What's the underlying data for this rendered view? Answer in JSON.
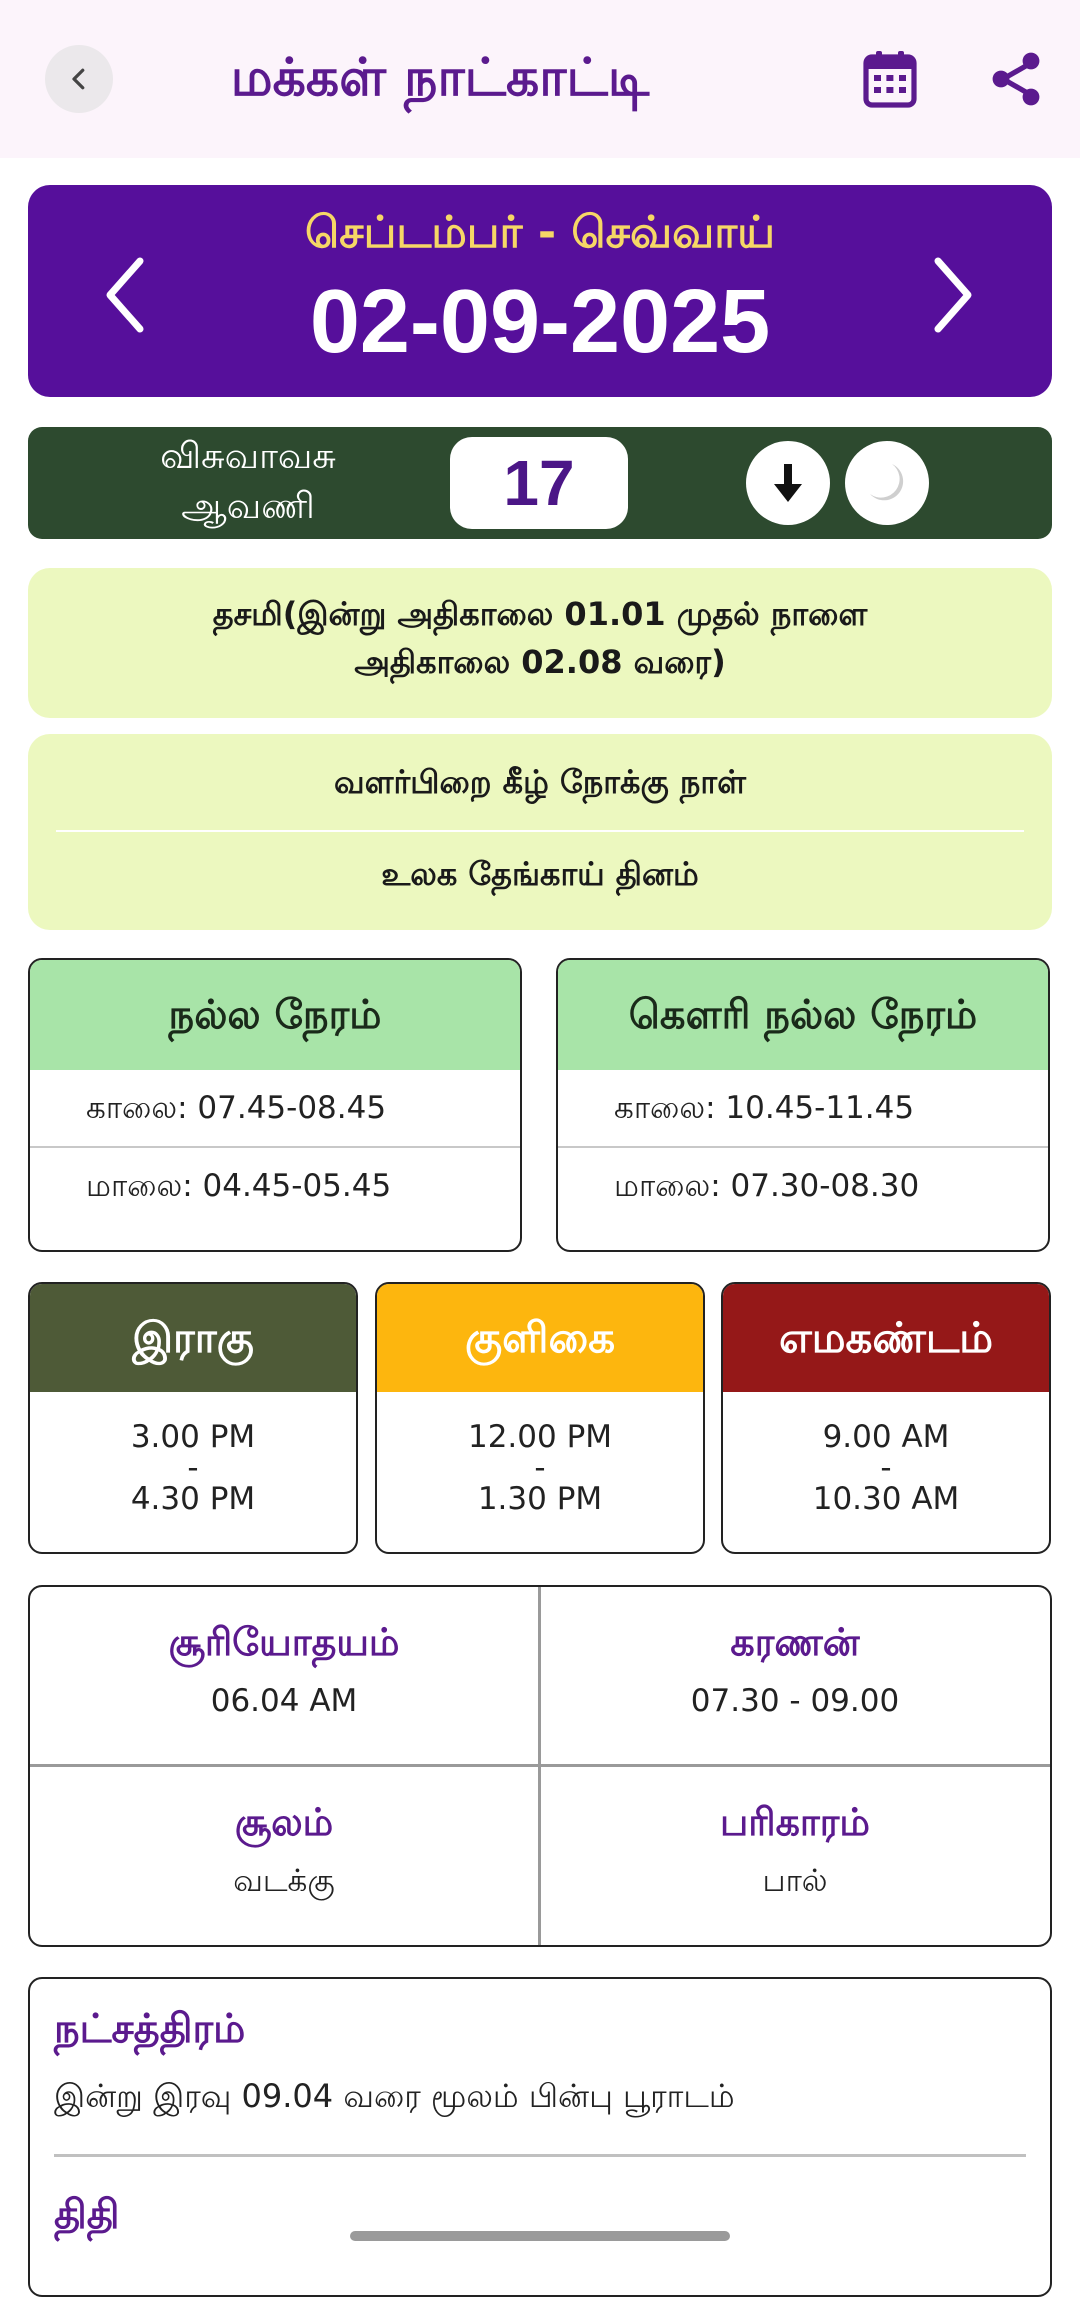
{
  "header": {
    "title": "மக்கள் நாட்காட்டி",
    "back_icon": "chevron-left-icon",
    "calendar_icon": "calendar-icon",
    "share_icon": "share-icon"
  },
  "date_card": {
    "month_day": "செப்டம்பர் - செவ்வாய்",
    "date": "02-09-2025",
    "prev_icon": "chevron-left-icon",
    "next_icon": "chevron-right-icon"
  },
  "tamil_bar": {
    "year": "விசுவாவசு",
    "month": "ஆவணி",
    "tamil_date": "17",
    "down_icon": "arrow-down-icon",
    "moon_icon": "crescent-moon-icon"
  },
  "tithi_info": {
    "line1": "தசமி(இன்று அதிகாலை 01.01 முதல் நாளை",
    "line2": "அதிகாலை 02.08 வரை)"
  },
  "notes": {
    "line1": "வளர்பிறை கீழ் நோக்கு நாள்",
    "line2": "உலக தேங்காய் தினம்"
  },
  "nalla_neram": {
    "title": "நல்ல நேரம்",
    "morning": "காலை: 07.45-08.45",
    "evening": "மாலை: 04.45-05.45"
  },
  "gowri_nalla_neram": {
    "title": "கௌரி நல்ல நேரம்",
    "morning": "காலை: 10.45-11.45",
    "evening": "மாலை: 07.30-08.30"
  },
  "periods": [
    {
      "title": "இராகு",
      "from": "3.00 PM",
      "sep": "-",
      "to": "4.30 PM",
      "color": "#4e5a37"
    },
    {
      "title": "குளிகை",
      "from": "12.00 PM",
      "sep": "-",
      "to": "1.30 PM",
      "color": "#fdb60e"
    },
    {
      "title": "எமகண்டம்",
      "from": "9.00 AM",
      "sep": "-",
      "to": "10.30 AM",
      "color": "#951818"
    }
  ],
  "grid": {
    "sunrise_title": "சூரியோதயம்",
    "sunrise_value": "06.04 AM",
    "karanan_title": "கரணன்",
    "karanan_value": "07.30 - 09.00",
    "soolam_title": "சூலம்",
    "soolam_value": "வடக்கு",
    "parikaram_title": "பரிகாரம்",
    "parikaram_value": "பால்"
  },
  "details": {
    "nakshatra_title": "நட்சத்திரம்",
    "nakshatra_text": "இன்று இரவு 09.04 வரை மூலம் பின்பு பூராடம்",
    "tithi_title": "திதி"
  }
}
